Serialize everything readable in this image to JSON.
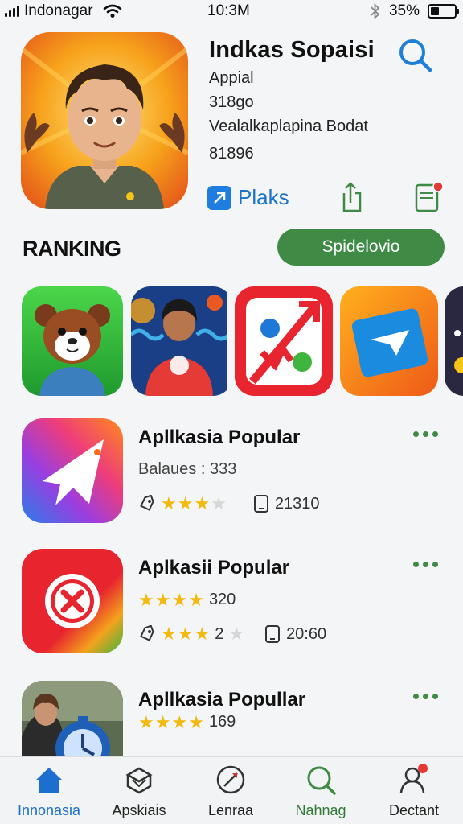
{
  "status_bar": {
    "carrier": "Indonagar",
    "time": "10:3M",
    "battery": "35%",
    "battery_level": 0.35
  },
  "header": {
    "app_title": "Indkas Sopaisi",
    "meta": [
      "Appial",
      "318go",
      "Vealalkaplapina Bodat",
      "81896"
    ],
    "plaks_label": "Plaks"
  },
  "ranking": {
    "label": "RANKING",
    "button_label": "Spidelovio"
  },
  "list": [
    {
      "title": "Apllkasia Popular",
      "subtitle": "Balaues : 333",
      "rating": 3,
      "count": "21310"
    },
    {
      "title": "Aplkasii Popular",
      "rating": 4,
      "rating_count": "320",
      "rating2": 2.5,
      "extra": "2",
      "count": "20:60"
    },
    {
      "title": "Apllkasia Popullar",
      "rating": 4,
      "rating_count": "169"
    }
  ],
  "bottom_nav": [
    {
      "label": "Innonasia",
      "icon": "home-icon",
      "active": true
    },
    {
      "label": "Apskiais",
      "icon": "box-icon"
    },
    {
      "label": "Lenraa",
      "icon": "compass-icon"
    },
    {
      "label": "Nahnag",
      "icon": "search-icon"
    },
    {
      "label": "Dectant",
      "icon": "profile-icon"
    }
  ],
  "colors": {
    "accent_green": "#3f8b46",
    "accent_blue": "#1d6fcf",
    "star": "#f2b90f",
    "badge_red": "#e53935"
  }
}
